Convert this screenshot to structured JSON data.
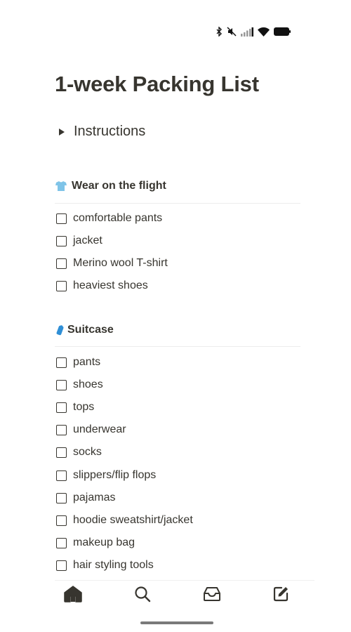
{
  "page": {
    "title": "1-week Packing List"
  },
  "toggle": {
    "label": "Instructions"
  },
  "sections": [
    {
      "heading": "Wear on the flight",
      "icon": "tshirt-icon",
      "items": [
        "comfortable pants",
        "jacket",
        "Merino wool T-shirt",
        "heaviest shoes"
      ]
    },
    {
      "heading": "Suitcase",
      "icon": "suitcase-icon",
      "items": [
        "pants",
        "shoes",
        "tops",
        "underwear",
        "socks",
        "slippers/flip flops",
        "pajamas",
        "hoodie sweatshirt/jacket",
        "makeup bag",
        "hair styling tools"
      ]
    }
  ],
  "status_bar": {
    "icons": [
      "bluetooth-icon",
      "mute-icon",
      "signal-icon",
      "wifi-icon",
      "battery-icon"
    ]
  },
  "tab_bar": {
    "tabs": [
      {
        "name": "home",
        "icon": "home-icon",
        "active": true
      },
      {
        "name": "search",
        "icon": "search-icon",
        "active": false
      },
      {
        "name": "inbox",
        "icon": "inbox-icon",
        "active": false
      },
      {
        "name": "new-page",
        "icon": "compose-icon",
        "active": false
      }
    ]
  },
  "colors": {
    "text": "#37352f",
    "divider": "#ececec",
    "tshirt": "#7fc4e8",
    "suitcase": "#2f8fd6"
  }
}
